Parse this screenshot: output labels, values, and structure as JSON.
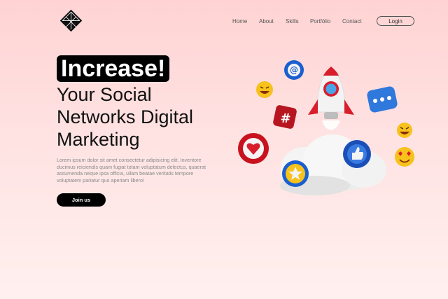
{
  "nav": {
    "items": [
      "Home",
      "About",
      "Skills",
      "Portfólio",
      "Contact"
    ],
    "login_label": "Login"
  },
  "hero": {
    "highlight": "Increase!",
    "line1": "Your Social",
    "line2": "Networks Digital",
    "line3": "Marketing",
    "paragraph": "Lorem ipsum dolor sit amet consectetur adipisicing elit. Inventore ducimus reiciendis quam fugiat totam voluptatum delectus, quaerat assumenda neque ipsa officia, ullam beatae veritatis tempore voluptatem pariatur quo aperiam libero!",
    "cta_label": "Join us"
  },
  "illustration": {
    "icons": [
      "rocket-icon",
      "at-icon",
      "laugh-emoji-icon",
      "hashtag-icon",
      "chat-bubble-icon",
      "heart-icon",
      "like-icon",
      "star-icon",
      "heart-eyes-emoji-icon"
    ],
    "colors": {
      "red": "#d81e2a",
      "blue": "#1a5fd0",
      "yellow": "#f6c21b",
      "cloud": "#f2f2f2"
    }
  }
}
